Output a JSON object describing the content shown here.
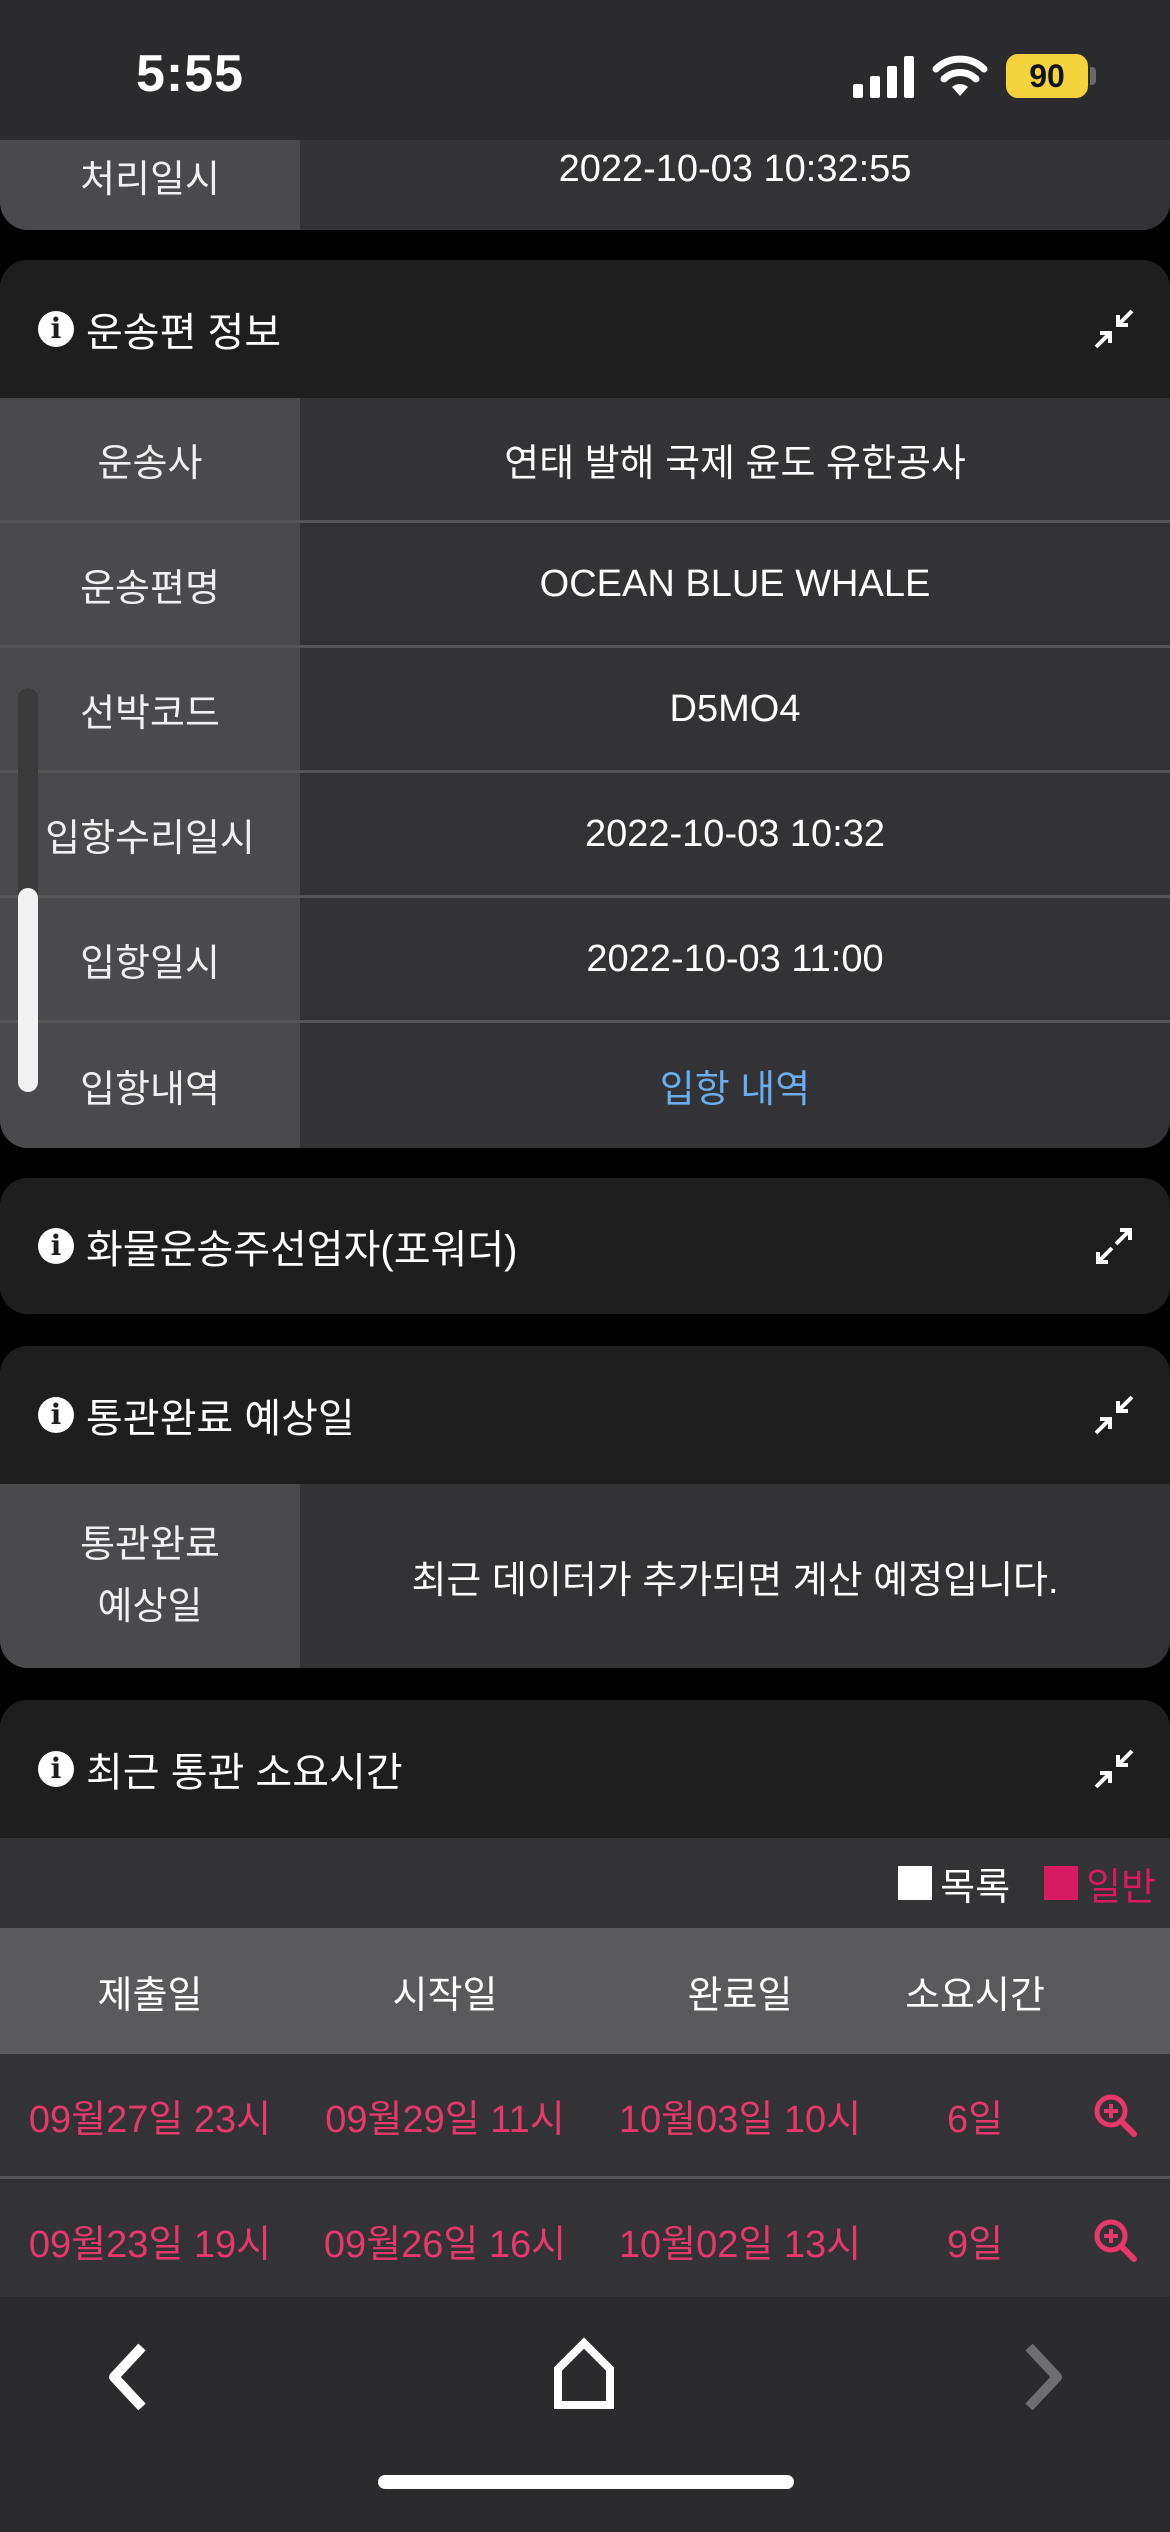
{
  "status_bar": {
    "time": "5:55",
    "battery": "90"
  },
  "top_card": {
    "label": "처리일시",
    "value": "2022-10-03 10:32:55"
  },
  "vessel_card": {
    "title": "운송편 정보",
    "rows": [
      {
        "label": "운송사",
        "value": "연태 발해 국제 윤도 유한공사"
      },
      {
        "label": "운송편명",
        "value": "OCEAN BLUE WHALE"
      },
      {
        "label": "선박코드",
        "value": "D5MO4"
      },
      {
        "label": "입항수리일시",
        "value": "2022-10-03 10:32"
      },
      {
        "label": "입항일시",
        "value": "2022-10-03 11:00"
      },
      {
        "label": "입항내역",
        "value": "입항 내역"
      }
    ]
  },
  "forwarder_card": {
    "title": "화물운송주선업자(포워더)"
  },
  "eta_card": {
    "title": "통관완료 예상일",
    "label_line1": "통관완료",
    "label_line2": "예상일",
    "value": "최근 데이터가 추가되면 계산 예정입니다."
  },
  "recent_card": {
    "title": "최근 통관 소요시간",
    "legend": [
      {
        "label": "목록",
        "color": "#ffffff"
      },
      {
        "label": "일반",
        "color": "#d81b60"
      }
    ],
    "columns": [
      "제출일",
      "시작일",
      "완료일",
      "소요시간"
    ],
    "rows": [
      {
        "submit": "09월27일 23시",
        "start": "09월29일 11시",
        "done": "10월03일 10시",
        "duration": "6일"
      },
      {
        "submit": "09월23일 19시",
        "start": "09월26일 16시",
        "done": "10월02일 13시",
        "duration": "9일"
      }
    ]
  },
  "colors": {
    "accent_link": "#6aaef0",
    "general_red": "#e6386c"
  },
  "icons": [
    "info-icon",
    "collapse-icon",
    "expand-icon",
    "zoom-in-icon",
    "back-chevron-icon",
    "home-icon",
    "forward-chevron-icon"
  ]
}
